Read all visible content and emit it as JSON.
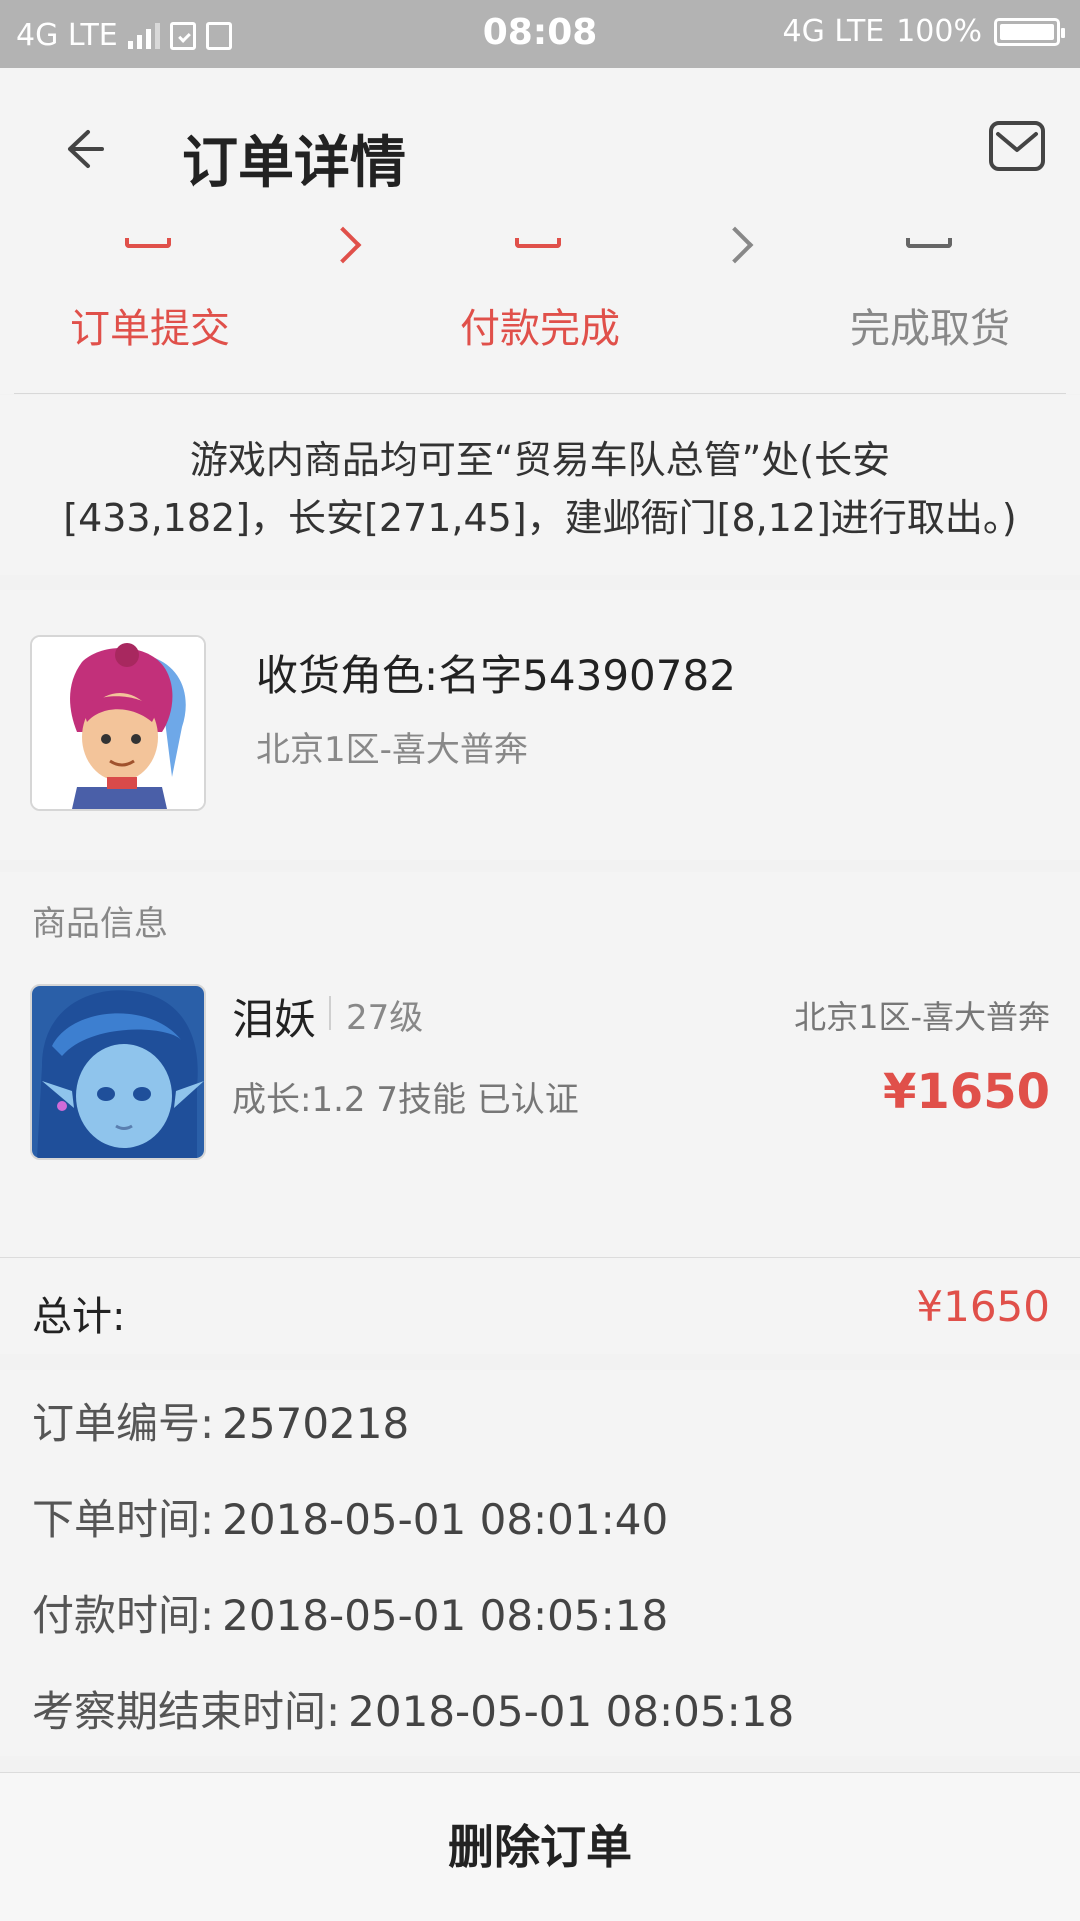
{
  "status_bar": {
    "network_left": "4G LTE",
    "time": "08:08",
    "network_right": "4G LTE",
    "battery": "100%"
  },
  "header": {
    "title": "订单详情",
    "back_icon": "back-arrow-icon",
    "message_icon": "mail-icon"
  },
  "progress": {
    "steps": [
      {
        "label": "订单提交",
        "color": "#e0504a"
      },
      {
        "label": "付款完成",
        "color": "#e0504a"
      },
      {
        "label": "完成取货",
        "color": "#888888"
      }
    ]
  },
  "notice": {
    "line1": "游戏内商品均可至“贸易车队总管”处(长安",
    "line2": "[433,182]，长安[271,45]，建邺衙门[8,12]进行取出。)"
  },
  "role": {
    "name": "收货角色:名字54390782",
    "server": "北京1区-喜大普奔",
    "avatar": "character-avatar"
  },
  "goods": {
    "section_title": "商品信息",
    "name": "泪妖",
    "level": "27级",
    "server": "北京1区-喜大普奔",
    "desc": "成长:1.2 7技能 已认证",
    "price": "¥1650",
    "image": "pet-avatar"
  },
  "total": {
    "label": "总计:",
    "value": "¥1650"
  },
  "order_info": {
    "rows": [
      {
        "label": "订单编号:",
        "value": "2570218"
      },
      {
        "label": "下单时间:",
        "value": "2018-05-01 08:01:40"
      },
      {
        "label": "付款时间:",
        "value": "2018-05-01 08:05:18"
      },
      {
        "label": "考察期结束时间:",
        "value": "2018-05-01 08:05:18"
      }
    ]
  },
  "actions": {
    "delete_label": "删除订单"
  },
  "colors": {
    "accent": "#e0504a",
    "muted": "#888888"
  }
}
